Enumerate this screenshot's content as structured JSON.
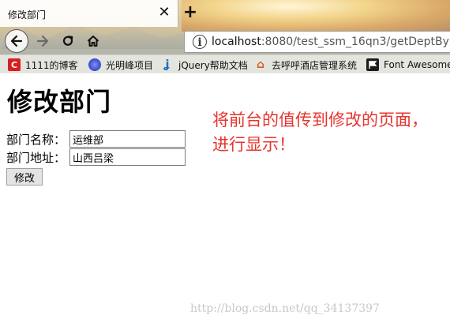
{
  "browser": {
    "tab_title": "修改部门",
    "tab_close": "✕",
    "new_tab": "+",
    "url_host": "localhost",
    "url_rest": ":8080/test_ssm_16qn3/getDeptById.",
    "bookmarks": [
      {
        "label": "1111的博客",
        "icon": "C"
      },
      {
        "label": "光明峰项目",
        "icon": "globe-icon"
      },
      {
        "label": "jQuery帮助文档",
        "icon": "jquery-icon"
      },
      {
        "label": "去呼呼酒店管理系统",
        "icon": "home-icon"
      },
      {
        "label": "Font Awesome",
        "icon": "flag-icon"
      }
    ]
  },
  "page": {
    "title": "修改部门",
    "annotation": "将前台的值传到修改的页面，进行显示！",
    "form": {
      "name_label": "部门名称：",
      "name_value": "运维部",
      "addr_label": "部门地址：",
      "addr_value": "山西吕梁",
      "submit_label": "修改"
    },
    "watermark": "http://blog.csdn.net/qq_34137397"
  }
}
